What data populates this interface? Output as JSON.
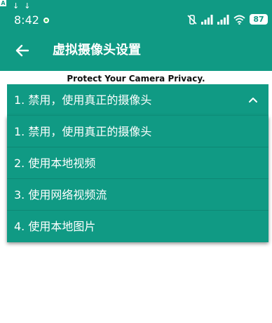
{
  "status_bar": {
    "arrows": "↓↓",
    "notification_letter": "A",
    "time": "8:42",
    "battery": "87",
    "icons": [
      "mute-vibrate-icon",
      "signal-icon",
      "signal-icon",
      "wifi-icon",
      "battery-icon"
    ]
  },
  "app_bar": {
    "title": "虚拟摄像头设置",
    "back_icon": "arrow-left-icon"
  },
  "banner": "Protect Your Camera Privacy.",
  "select": {
    "selected": "1. 禁用，使用真正的摄像头",
    "expanded_icon": "chevron-up-icon",
    "options": [
      "1. 禁用，使用真正的摄像头",
      "2. 使用本地视频",
      "3. 使用网络视频流",
      "4. 使用本地图片"
    ]
  },
  "colors": {
    "primary": "#109a84",
    "text_on_primary": "#ffffff"
  }
}
